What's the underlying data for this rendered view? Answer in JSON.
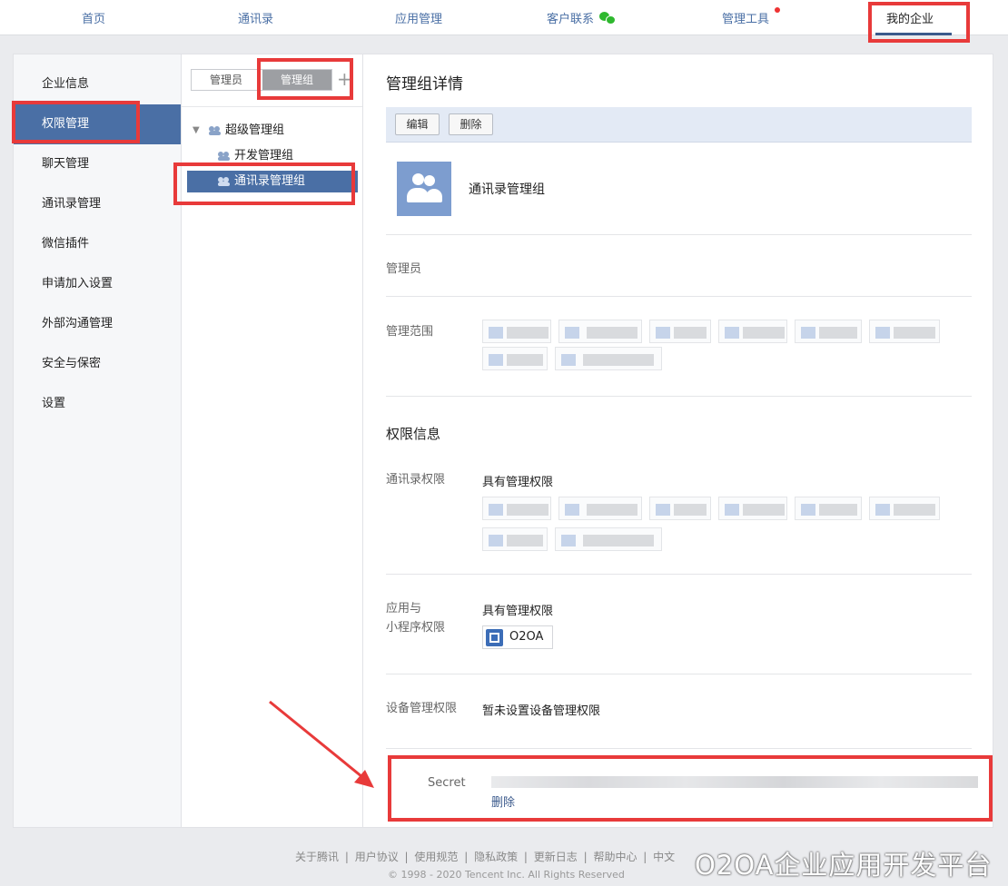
{
  "nav": {
    "items": [
      "首页",
      "通讯录",
      "应用管理",
      "客户联系",
      "管理工具",
      "我的企业"
    ],
    "active": "我的企业"
  },
  "sidebar": {
    "items": [
      "企业信息",
      "权限管理",
      "聊天管理",
      "通讯录管理",
      "微信插件",
      "申请加入设置",
      "外部沟通管理",
      "安全与保密",
      "设置"
    ],
    "active": "权限管理"
  },
  "mid": {
    "tab_admin": "管理员",
    "tab_group": "管理组",
    "add_icon": "+",
    "tree": {
      "root": "超级管理组",
      "children": [
        "开发管理组",
        "通讯录管理组"
      ],
      "selected": "通讯录管理组"
    }
  },
  "detail": {
    "title": "管理组详情",
    "edit_label": "编辑",
    "delete_label": "删除",
    "group_name": "通讯录管理组",
    "admin_label": "管理员",
    "scope_label": "管理范围",
    "perm_title": "权限信息",
    "contacts_perm_label": "通讯录权限",
    "contacts_perm_value": "具有管理权限",
    "app_perm_label_1": "应用与",
    "app_perm_label_2": "小程序权限",
    "app_perm_value": "具有管理权限",
    "app_name": "O2OA",
    "device_perm_label": "设备管理权限",
    "device_perm_value": "暂未设置设备管理权限",
    "secret_label": "Secret",
    "secret_delete": "删除"
  },
  "footer": {
    "links": [
      "关于腾讯",
      "用户协议",
      "使用规范",
      "隐私政策",
      "更新日志",
      "帮助中心",
      "中文"
    ],
    "copyright": "© 1998 - 2020 Tencent Inc. All Rights Reserved"
  },
  "watermark": "O2OA企业应用开发平台",
  "colors": {
    "accent": "#4a6fa5",
    "annotation": "#e83a3a"
  }
}
